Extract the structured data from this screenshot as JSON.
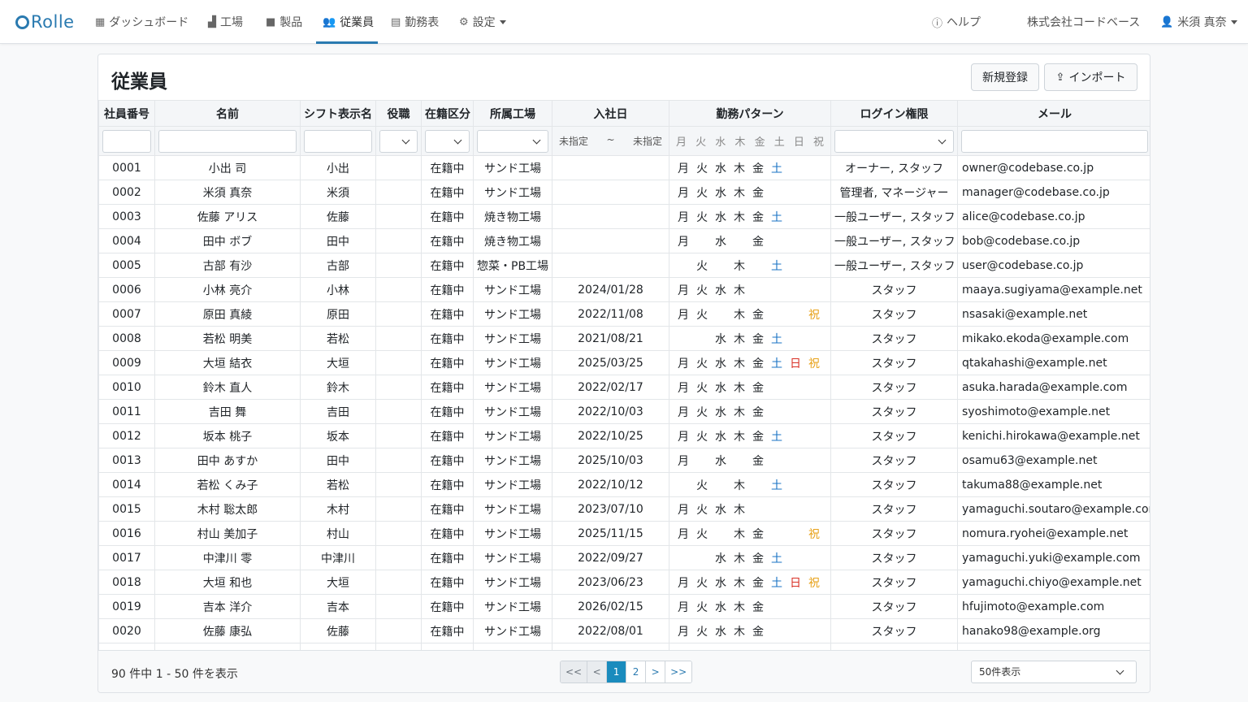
{
  "nav": {
    "logo": "Rolle",
    "items": [
      {
        "label": "ダッシュボード",
        "icon": "dashboard-icon"
      },
      {
        "label": "工場",
        "icon": "factory-icon"
      },
      {
        "label": "製品",
        "icon": "box-icon"
      },
      {
        "label": "従業員",
        "icon": "users-icon",
        "active": true
      },
      {
        "label": "勤務表",
        "icon": "schedule-icon"
      },
      {
        "label": "設定",
        "icon": "gear-icon"
      }
    ],
    "help": "ヘルプ",
    "company": "株式会社コードベース",
    "user": "米須 真奈"
  },
  "page": {
    "title": "従業員",
    "new_button": "新規登録",
    "import_button": "インポート"
  },
  "table": {
    "columns": [
      "社員番号",
      "名前",
      "シフト表示名",
      "役職",
      "在籍区分",
      "所属工場",
      "入社日",
      "勤務パターン",
      "ログイン権限",
      "メール"
    ],
    "date_filter": {
      "from": "未指定",
      "sep": "~",
      "to": "未指定"
    },
    "day_labels": [
      "月",
      "火",
      "水",
      "木",
      "金",
      "土",
      "日",
      "祝"
    ],
    "rows": [
      {
        "id": "0001",
        "name": "小出 司",
        "shift": "小出",
        "role": "",
        "status": "在籍中",
        "factory": "サンド工場",
        "joined": "",
        "days": [
          1,
          1,
          1,
          1,
          1,
          1,
          0,
          0
        ],
        "perm": "オーナー, スタッフ",
        "email": "owner@codebase.co.jp"
      },
      {
        "id": "0002",
        "name": "米須 真奈",
        "shift": "米須",
        "role": "",
        "status": "在籍中",
        "factory": "サンド工場",
        "joined": "",
        "days": [
          1,
          1,
          1,
          1,
          1,
          0,
          0,
          0
        ],
        "perm": "管理者, マネージャー",
        "email": "manager@codebase.co.jp"
      },
      {
        "id": "0003",
        "name": "佐藤 アリス",
        "shift": "佐藤",
        "role": "",
        "status": "在籍中",
        "factory": "焼き物工場",
        "joined": "",
        "days": [
          1,
          1,
          1,
          1,
          1,
          1,
          0,
          0
        ],
        "perm": "一般ユーザー, スタッフ",
        "email": "alice@codebase.co.jp"
      },
      {
        "id": "0004",
        "name": "田中 ボブ",
        "shift": "田中",
        "role": "",
        "status": "在籍中",
        "factory": "焼き物工場",
        "joined": "",
        "days": [
          1,
          0,
          1,
          0,
          1,
          0,
          0,
          0
        ],
        "perm": "一般ユーザー, スタッフ",
        "email": "bob@codebase.co.jp"
      },
      {
        "id": "0005",
        "name": "古部 有沙",
        "shift": "古部",
        "role": "",
        "status": "在籍中",
        "factory": "惣菜・PB工場",
        "joined": "",
        "days": [
          0,
          1,
          0,
          1,
          0,
          1,
          0,
          0
        ],
        "perm": "一般ユーザー, スタッフ",
        "email": "user@codebase.co.jp"
      },
      {
        "id": "0006",
        "name": "小林 亮介",
        "shift": "小林",
        "role": "",
        "status": "在籍中",
        "factory": "サンド工場",
        "joined": "2024/01/28",
        "days": [
          1,
          1,
          1,
          1,
          0,
          0,
          0,
          0
        ],
        "perm": "スタッフ",
        "email": "maaya.sugiyama@example.net"
      },
      {
        "id": "0007",
        "name": "原田 真綾",
        "shift": "原田",
        "role": "",
        "status": "在籍中",
        "factory": "サンド工場",
        "joined": "2022/11/08",
        "days": [
          1,
          1,
          0,
          1,
          1,
          0,
          0,
          1
        ],
        "perm": "スタッフ",
        "email": "nsasaki@example.net"
      },
      {
        "id": "0008",
        "name": "若松 明美",
        "shift": "若松",
        "role": "",
        "status": "在籍中",
        "factory": "サンド工場",
        "joined": "2021/08/21",
        "days": [
          0,
          0,
          1,
          1,
          1,
          1,
          0,
          0
        ],
        "perm": "スタッフ",
        "email": "mikako.ekoda@example.com"
      },
      {
        "id": "0009",
        "name": "大垣 結衣",
        "shift": "大垣",
        "role": "",
        "status": "在籍中",
        "factory": "サンド工場",
        "joined": "2025/03/25",
        "days": [
          1,
          1,
          1,
          1,
          1,
          1,
          1,
          1
        ],
        "perm": "スタッフ",
        "email": "qtakahashi@example.net"
      },
      {
        "id": "0010",
        "name": "鈴木 直人",
        "shift": "鈴木",
        "role": "",
        "status": "在籍中",
        "factory": "サンド工場",
        "joined": "2022/02/17",
        "days": [
          1,
          1,
          1,
          1,
          1,
          0,
          0,
          0
        ],
        "perm": "スタッフ",
        "email": "asuka.harada@example.com"
      },
      {
        "id": "0011",
        "name": "吉田 舞",
        "shift": "吉田",
        "role": "",
        "status": "在籍中",
        "factory": "サンド工場",
        "joined": "2022/10/03",
        "days": [
          1,
          1,
          1,
          1,
          1,
          0,
          0,
          0
        ],
        "perm": "スタッフ",
        "email": "syoshimoto@example.net"
      },
      {
        "id": "0012",
        "name": "坂本 桃子",
        "shift": "坂本",
        "role": "",
        "status": "在籍中",
        "factory": "サンド工場",
        "joined": "2022/10/25",
        "days": [
          1,
          1,
          1,
          1,
          1,
          1,
          0,
          0
        ],
        "perm": "スタッフ",
        "email": "kenichi.hirokawa@example.net"
      },
      {
        "id": "0013",
        "name": "田中 あすか",
        "shift": "田中",
        "role": "",
        "status": "在籍中",
        "factory": "サンド工場",
        "joined": "2025/10/03",
        "days": [
          1,
          0,
          1,
          0,
          1,
          0,
          0,
          0
        ],
        "perm": "スタッフ",
        "email": "osamu63@example.net"
      },
      {
        "id": "0014",
        "name": "若松 くみ子",
        "shift": "若松",
        "role": "",
        "status": "在籍中",
        "factory": "サンド工場",
        "joined": "2022/10/12",
        "days": [
          0,
          1,
          0,
          1,
          0,
          1,
          0,
          0
        ],
        "perm": "スタッフ",
        "email": "takuma88@example.net"
      },
      {
        "id": "0015",
        "name": "木村 聡太郎",
        "shift": "木村",
        "role": "",
        "status": "在籍中",
        "factory": "サンド工場",
        "joined": "2023/07/10",
        "days": [
          1,
          1,
          1,
          1,
          0,
          0,
          0,
          0
        ],
        "perm": "スタッフ",
        "email": "yamaguchi.soutaro@example.com"
      },
      {
        "id": "0016",
        "name": "村山 美加子",
        "shift": "村山",
        "role": "",
        "status": "在籍中",
        "factory": "サンド工場",
        "joined": "2025/11/15",
        "days": [
          1,
          1,
          0,
          1,
          1,
          0,
          0,
          1
        ],
        "perm": "スタッフ",
        "email": "nomura.ryohei@example.net"
      },
      {
        "id": "0017",
        "name": "中津川 零",
        "shift": "中津川",
        "role": "",
        "status": "在籍中",
        "factory": "サンド工場",
        "joined": "2022/09/27",
        "days": [
          0,
          0,
          1,
          1,
          1,
          1,
          0,
          0
        ],
        "perm": "スタッフ",
        "email": "yamaguchi.yuki@example.com"
      },
      {
        "id": "0018",
        "name": "大垣 和也",
        "shift": "大垣",
        "role": "",
        "status": "在籍中",
        "factory": "サンド工場",
        "joined": "2023/06/23",
        "days": [
          1,
          1,
          1,
          1,
          1,
          1,
          1,
          1
        ],
        "perm": "スタッフ",
        "email": "yamaguchi.chiyo@example.net"
      },
      {
        "id": "0019",
        "name": "吉本 洋介",
        "shift": "吉本",
        "role": "",
        "status": "在籍中",
        "factory": "サンド工場",
        "joined": "2026/02/15",
        "days": [
          1,
          1,
          1,
          1,
          1,
          0,
          0,
          0
        ],
        "perm": "スタッフ",
        "email": "hfujimoto@example.com"
      },
      {
        "id": "0020",
        "name": "佐藤 康弘",
        "shift": "佐藤",
        "role": "",
        "status": "在籍中",
        "factory": "サンド工場",
        "joined": "2022/08/01",
        "days": [
          1,
          1,
          1,
          1,
          1,
          0,
          0,
          0
        ],
        "perm": "スタッフ",
        "email": "hanako98@example.org"
      }
    ]
  },
  "footer": {
    "count_text": "90 件中 1 - 50 件を表示",
    "pager": [
      "<<",
      "<",
      "1",
      "2",
      ">",
      ">>"
    ],
    "per_page": "50件表示"
  },
  "colors": {
    "accent": "#2a7ab0",
    "saturday": "#1a73c4",
    "sunday": "#d93025",
    "holiday": "#e8a21a"
  }
}
